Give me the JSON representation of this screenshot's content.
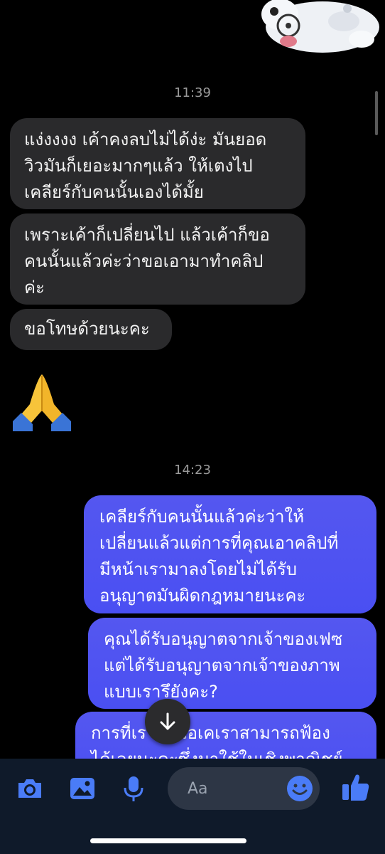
{
  "thread": {
    "timestamps": [
      "11:39",
      "14:23"
    ],
    "incoming": [
      "แง่งงงง เค้าคงลบไม่ได้ง่ะ มันยอด\nวิวมันก็เยอะมากๆแล้ว ให้เตงไป\nเคลียร์กับคนนั้นเองได้มั้ย",
      "เพราะเค้าก็เปลี่ยนไป แล้วเค้าก็ขอ\nคนนั้นแล้วค่ะว่าขอเอามาทำคลิป\nค่ะ",
      "ขอโทษด้วยนะคะ"
    ],
    "emoji": "🙏",
    "outgoing": [
      "เคลียร์กับคนนั้นแล้วค่ะว่าให้\nเปลี่ยนแล้วแต่การที่คุณเอาคลิปที่\nมีหน้าเรามาลงโดยไม่ได้รับ\nอนุญาตมันผิดกฎหมายนะคะ",
      "คุณได้รับอนุญาตจากเจ้าของเฟซ\nแต่ได้รับอนุญาตจากเจ้าของภาพ\nแบบเรารึยังคะ?",
      "การที่เราเอาเอเคเราสามารถฟ้อง\nได้เลยนะคะซึ่งมาใช้ในเชิงพาณิชย์"
    ]
  },
  "composer": {
    "placeholder": "Aa",
    "icons": [
      "camera-icon",
      "image-icon",
      "microphone-icon",
      "emoji-icon",
      "thumbs-up-icon"
    ]
  },
  "colors": {
    "accent": "#4a7cf7",
    "outgoing_bubble": "#4f52f0",
    "incoming_bubble": "#2a2a2c",
    "composer_bg": "#0f1a2a"
  }
}
